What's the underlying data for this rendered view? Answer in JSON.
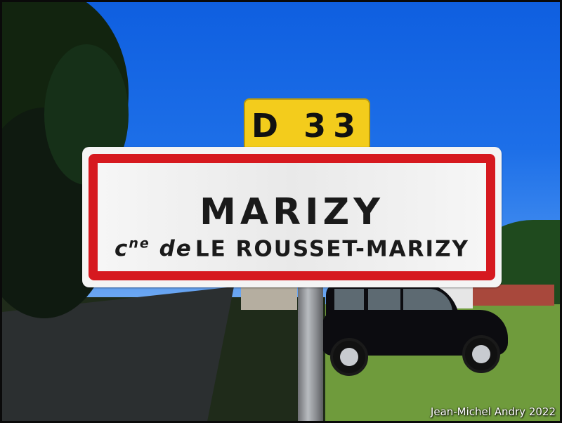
{
  "route_plate": {
    "text": "D 33"
  },
  "town_sign": {
    "town_name": "MARIZY",
    "commune_prefix": "c",
    "commune_prefix_sup": "ne",
    "commune_de": "de",
    "commune_name": "LE ROUSSET-MARIZY"
  },
  "credit": "Jean-Michel Andry 2022",
  "colors": {
    "sky": "#1d6fe8",
    "sign_border": "#d6191f",
    "route_plate": "#f3cc1c",
    "grass": "#6f9b3c"
  }
}
